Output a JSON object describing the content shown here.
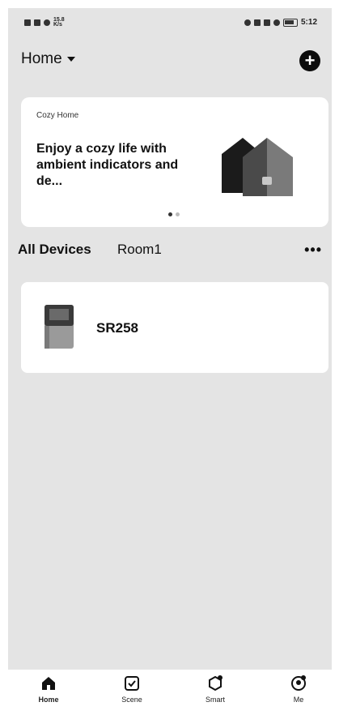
{
  "status_bar": {
    "network_speed": "15.8 K/s",
    "time": "5:12"
  },
  "header": {
    "home_label": "Home",
    "add_button_label": "+"
  },
  "banner": {
    "eyebrow": "Cozy Home",
    "headline": "Enjoy a cozy life with ambient indicators and de...",
    "pages_total": 2,
    "active_page": 1
  },
  "device_tabs": {
    "tabs": [
      {
        "label": "All Devices",
        "active": true
      },
      {
        "label": "Room1",
        "active": false
      }
    ],
    "more_label": "•••"
  },
  "devices": [
    {
      "name": "SR258"
    }
  ],
  "bottom_nav": {
    "items": [
      {
        "label": "Home",
        "icon": "home-icon",
        "active": true
      },
      {
        "label": "Scene",
        "icon": "scene-check-icon",
        "active": false
      },
      {
        "label": "Smart",
        "icon": "smart-icon",
        "active": false
      },
      {
        "label": "Me",
        "icon": "profile-icon",
        "active": false
      }
    ]
  },
  "colors": {
    "screen_background": "#e4e4e4",
    "card_background": "#ffffff",
    "primary_text": "#111111"
  }
}
